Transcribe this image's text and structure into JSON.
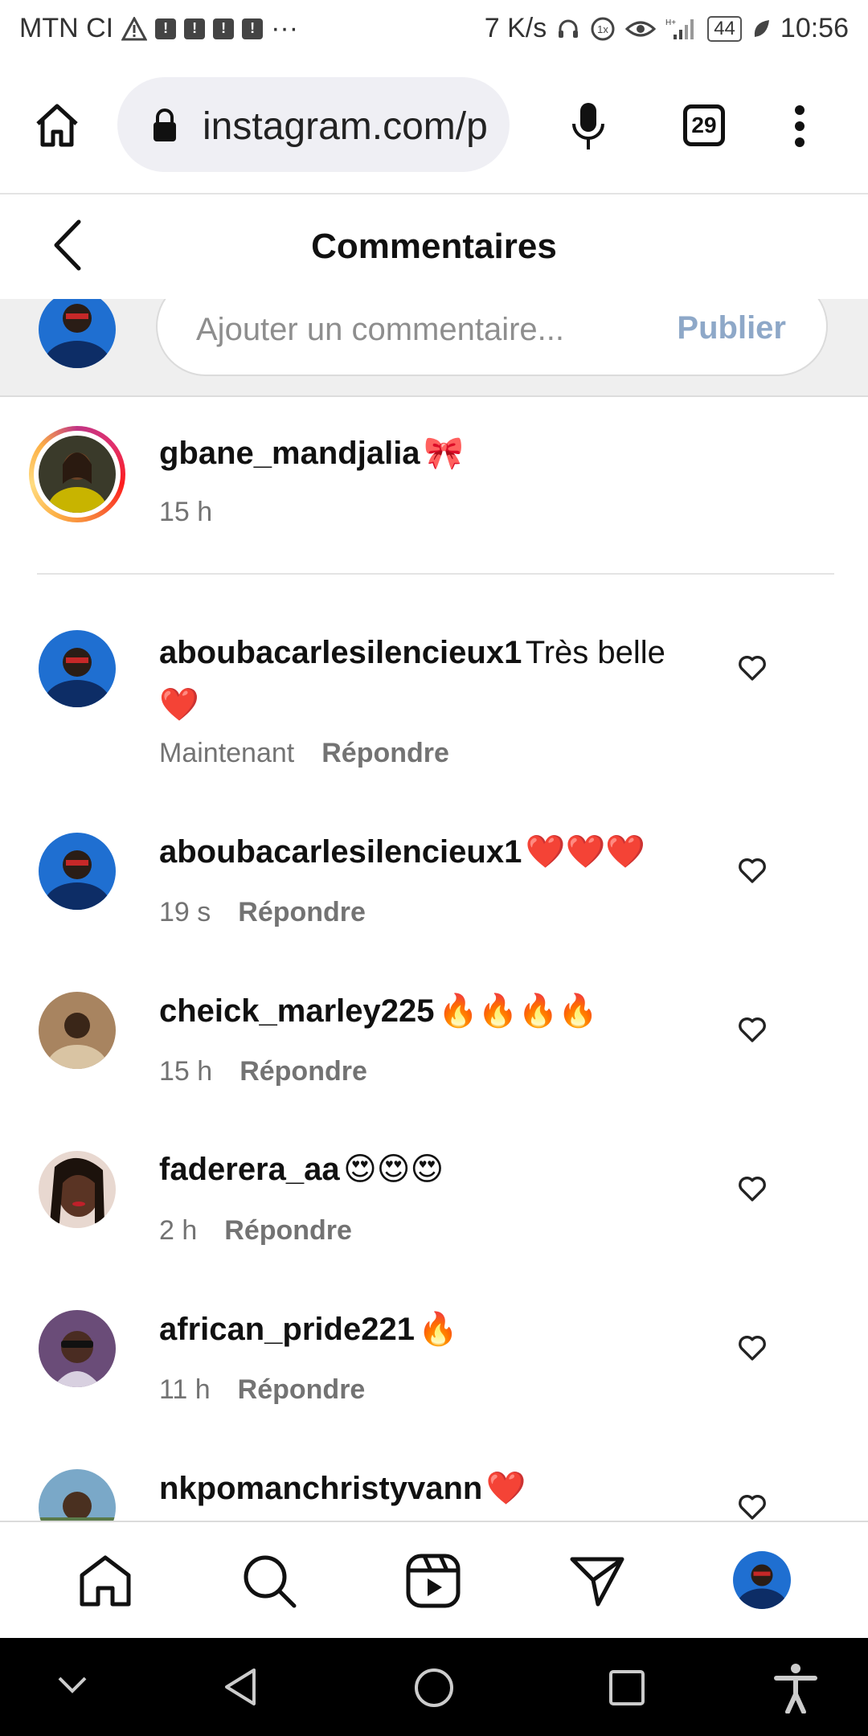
{
  "status_bar": {
    "carrier": "MTN CI",
    "notif_icon": "!",
    "speed": "7 K/s",
    "battery": "44",
    "time": "10:56"
  },
  "browser": {
    "url": "instagram.com/p",
    "tab_count": "29"
  },
  "header": {
    "title": "Commentaires"
  },
  "add_comment": {
    "placeholder": "Ajouter un commentaire...",
    "publish_label": "Publier"
  },
  "caption": {
    "username": "gbane_mandjalia",
    "text": "🎀",
    "time": "15 h"
  },
  "comments": [
    {
      "username": "aboubacarlesilencieux1",
      "text": "Très belle ❤️",
      "time": "Maintenant",
      "reply": "Répondre"
    },
    {
      "username": "aboubacarlesilencieux1",
      "text": "❤️❤️❤️",
      "time": "19 s",
      "reply": "Répondre"
    },
    {
      "username": "cheick_marley225",
      "text": "🔥🔥🔥🔥",
      "time": "15 h",
      "reply": "Répondre"
    },
    {
      "username": "faderera_aa",
      "text": "😍😍😍",
      "time": "2 h",
      "reply": "Répondre"
    },
    {
      "username": "african_pride221",
      "text": "🔥",
      "time": "11 h",
      "reply": "Répondre"
    },
    {
      "username": "nkpomanchristyvann",
      "text": "❤️"
    }
  ],
  "colors": {
    "publish": "#8ea8c8",
    "secondary_text": "#737373",
    "heart_red": "#ed2a2a"
  },
  "icons": [
    "home-icon",
    "lock-icon",
    "mic-icon",
    "more-icon",
    "back-icon",
    "heart-icon",
    "search-icon",
    "reels-icon",
    "send-icon",
    "profile-avatar"
  ]
}
